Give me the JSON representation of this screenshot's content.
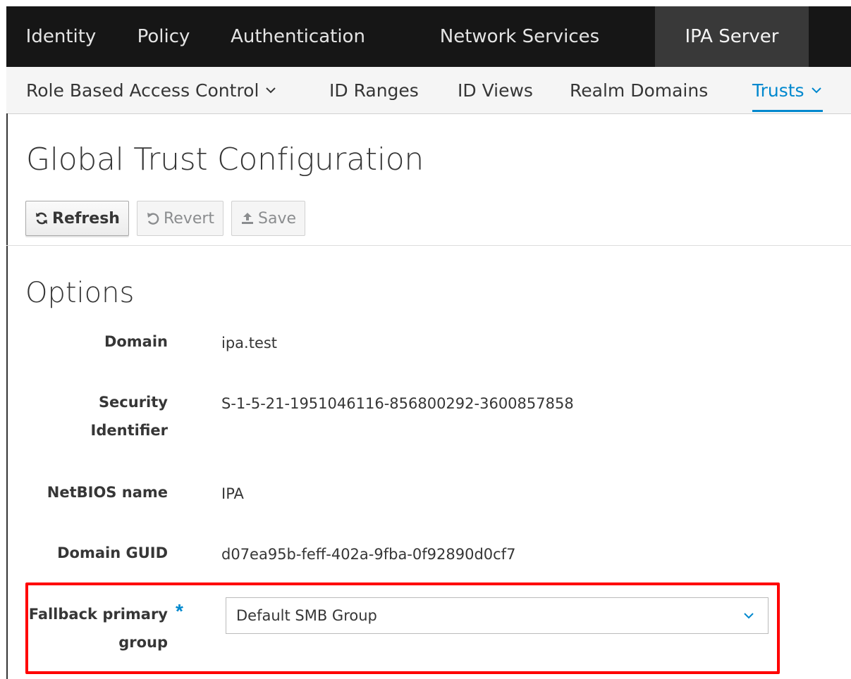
{
  "top_nav": {
    "items": [
      {
        "label": "Identity"
      },
      {
        "label": "Policy"
      },
      {
        "label": "Authentication"
      },
      {
        "label": "Network Services"
      },
      {
        "label": "IPA Server",
        "active": true
      }
    ]
  },
  "sub_nav": {
    "items": [
      {
        "label": "Role Based Access Control",
        "has_dropdown": true
      },
      {
        "label": "ID Ranges"
      },
      {
        "label": "ID Views"
      },
      {
        "label": "Realm Domains"
      },
      {
        "label": "Trusts",
        "has_dropdown": true,
        "active": true
      }
    ]
  },
  "page": {
    "title": "Global Trust Configuration"
  },
  "toolbar": {
    "refresh_label": "Refresh",
    "revert_label": "Revert",
    "save_label": "Save"
  },
  "options": {
    "title": "Options",
    "fields": [
      {
        "label": "Domain",
        "value": "ipa.test"
      },
      {
        "label_line1": "Security",
        "label_line2": "Identifier",
        "value": "S-1-5-21-1951046116-856800292-3600857858"
      },
      {
        "label": "NetBIOS name",
        "value": "IPA"
      },
      {
        "label": "Domain GUID",
        "value": "d07ea95b-feff-402a-9fba-0f92890d0cf7"
      }
    ],
    "fallback": {
      "label_line1": "Fallback primary",
      "label_line2": "group",
      "required_marker": "*",
      "selected": "Default SMB Group"
    }
  },
  "colors": {
    "top_nav_bg": "#161616",
    "active_top_bg": "#393939",
    "accent": "#0088ce",
    "highlight": "#ff0000"
  }
}
